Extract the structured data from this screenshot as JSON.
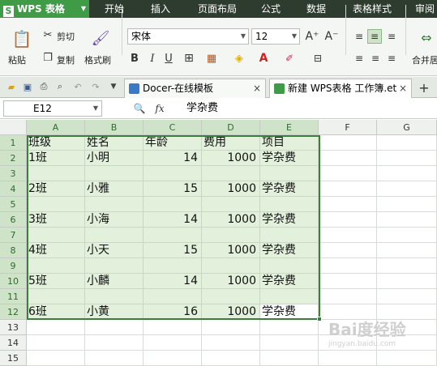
{
  "app": {
    "name": "WPS 表格",
    "logo": "S"
  },
  "menu": {
    "tabs": [
      "开始",
      "插入",
      "页面布局",
      "公式",
      "数据",
      "表格样式",
      "审阅"
    ],
    "active": 0
  },
  "ribbon": {
    "paste": "粘贴",
    "cut": "剪切",
    "copy": "复制",
    "format_painter": "格式刷",
    "font_name": "宋体",
    "font_size": "12",
    "bold": "B",
    "italic": "I",
    "underline": "U",
    "grow_font": "A⁺",
    "shrink_font": "A⁻",
    "merge_center": "合并居中"
  },
  "file_tabs": [
    {
      "label": "Docer-在线模板",
      "close": "×"
    },
    {
      "label": "新建 WPS表格 工作簿.et",
      "close": "×"
    }
  ],
  "new_tab": "+",
  "formula_bar": {
    "cell_ref": "E12",
    "fx": "fx",
    "value": "学杂费"
  },
  "sheet": {
    "columns": [
      "A",
      "B",
      "C",
      "D",
      "E",
      "F",
      "G"
    ],
    "rows": [
      "1",
      "2",
      "3",
      "4",
      "5",
      "6",
      "7",
      "8",
      "9",
      "10",
      "11",
      "12",
      "13",
      "14",
      "15"
    ],
    "cells": [
      [
        "班级",
        "姓名",
        "年龄",
        "费用",
        "项目"
      ],
      [
        "1班",
        "小明",
        "14",
        "1000",
        "学杂费"
      ],
      [
        "",
        "",
        "",
        "",
        ""
      ],
      [
        "2班",
        "小雅",
        "15",
        "1000",
        "学杂费"
      ],
      [
        "",
        "",
        "",
        "",
        ""
      ],
      [
        "3班",
        "小海",
        "14",
        "1000",
        "学杂费"
      ],
      [
        "",
        "",
        "",
        "",
        ""
      ],
      [
        "4班",
        "小天",
        "15",
        "1000",
        "学杂费"
      ],
      [
        "",
        "",
        "",
        "",
        ""
      ],
      [
        "5班",
        "小麟",
        "14",
        "1000",
        "学杂费"
      ],
      [
        "",
        "",
        "",
        "",
        ""
      ],
      [
        "6班",
        "小黄",
        "16",
        "1000",
        "学杂费"
      ]
    ]
  },
  "watermark": {
    "text": "Bai度经验",
    "sub": "jingyan.baidu.com"
  },
  "colors": {
    "accent": "#3f9b45",
    "menubar": "#2e3b2f",
    "selection": "#e3f1dc"
  }
}
